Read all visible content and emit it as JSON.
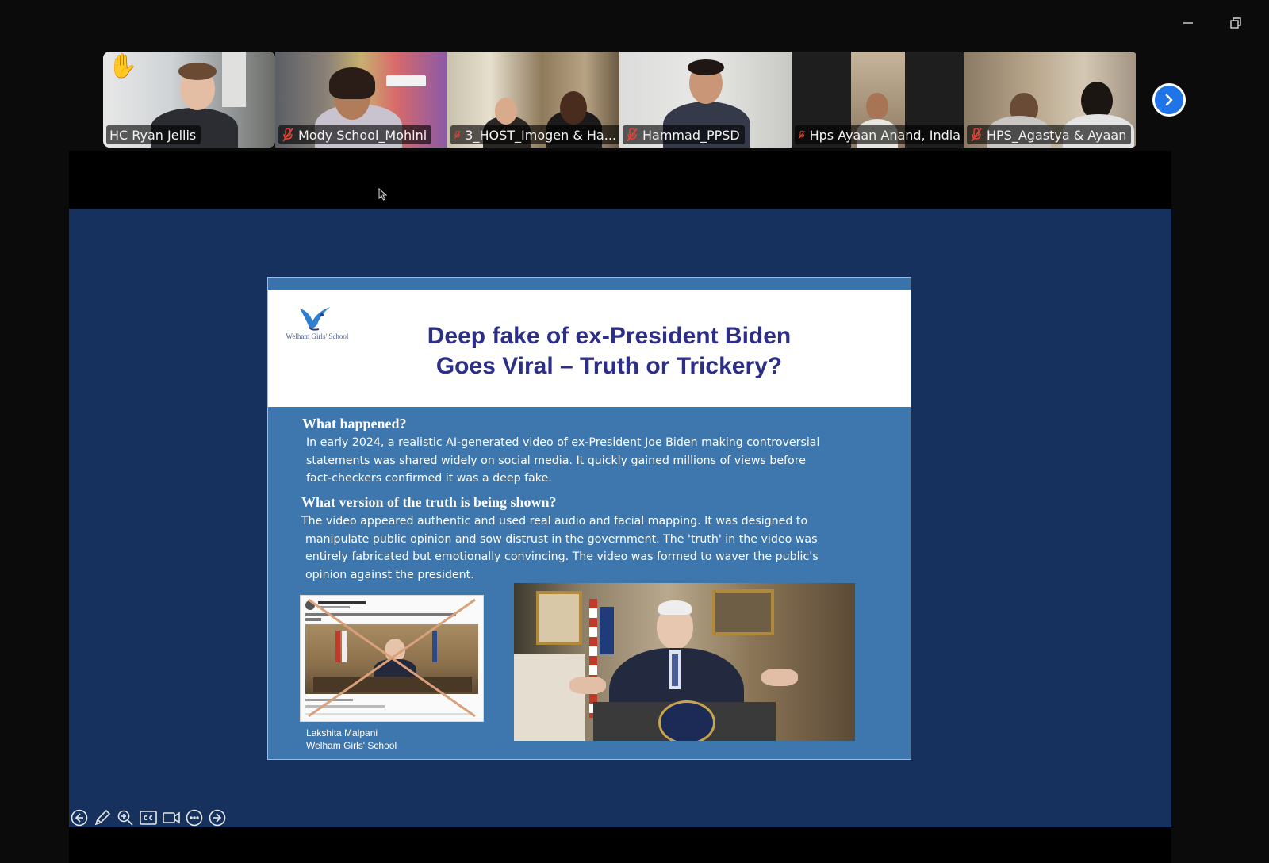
{
  "window": {
    "minimize_icon": "minimize-icon",
    "restore_icon": "restore-icon"
  },
  "participants": [
    {
      "name": "HC Ryan Jellis",
      "muted": false,
      "hand_raised": true,
      "active": true
    },
    {
      "name": "Mody School_Mohini",
      "muted": true
    },
    {
      "name": "3_HOST_Imogen & Ha...",
      "muted": true
    },
    {
      "name": "Hammad_PPSD",
      "muted": true
    },
    {
      "name": "Hps Ayaan Anand, India",
      "muted": true
    },
    {
      "name": "HPS_Agastya & Ayaan",
      "muted": true
    }
  ],
  "colors": {
    "active_speaker": "#22d36b",
    "share_background": "#17315e",
    "slide_body": "#3d77ad",
    "slide_title": "#2d2f86",
    "next_button": "#1f74e8"
  },
  "slide": {
    "logo_text": "Welham Girls' School",
    "title_line1": "Deep fake of ex-President Biden",
    "title_line2": "Goes Viral – Truth or Trickery?",
    "heading1": "What happened?",
    "para1_l1": "In early 2024, a realistic AI-generated video of ex-President Joe Biden making controversial",
    "para1_l2": "statements was shared widely on social media. It quickly gained millions of views before",
    "para1_l3": "fact-checkers confirmed it was a deep fake.",
    "heading2": "What version of the truth is being shown?",
    "para2_l1": "The video appeared authentic and used real audio and facial mapping. It was designed to",
    "para2_l2": "manipulate public opinion and sow distrust in the government. The 'truth' in the video was",
    "para2_l3": "entirely fabricated but emotionally convincing. The video was formed to waver the public's",
    "para2_l4": "opinion against the president.",
    "credit_name": "Lakshita Malpani",
    "credit_school": "Welham Girls' School"
  },
  "toolbar": {
    "items": [
      "previous-slide-icon",
      "pen-icon",
      "zoom-icon",
      "captions-icon",
      "video-icon",
      "more-options-icon",
      "next-slide-icon"
    ]
  }
}
